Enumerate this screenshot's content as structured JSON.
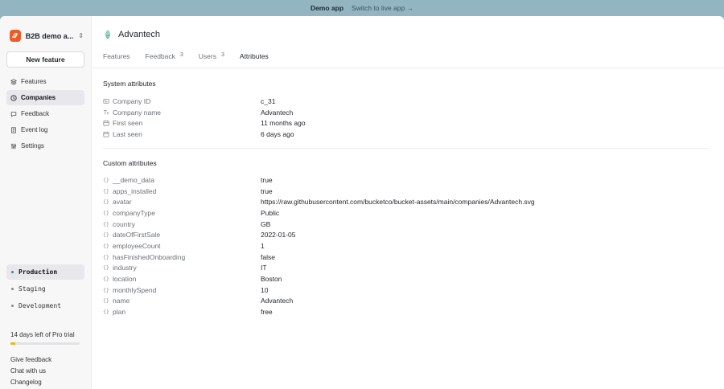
{
  "banner": {
    "demo_label": "Demo app",
    "switch_label": "Switch to live app →"
  },
  "sidebar": {
    "org_name": "B2B demo a...",
    "new_feature_label": "New feature",
    "nav": [
      {
        "label": "Features",
        "icon": "features-icon"
      },
      {
        "label": "Companies",
        "icon": "companies-icon",
        "active": true
      },
      {
        "label": "Feedback",
        "icon": "feedback-icon"
      },
      {
        "label": "Event log",
        "icon": "event-log-icon"
      },
      {
        "label": "Settings",
        "icon": "settings-icon"
      }
    ],
    "environments": [
      {
        "label": "Production",
        "active": true
      },
      {
        "label": "Staging"
      },
      {
        "label": "Development"
      }
    ],
    "trial_text": "14 days left of Pro trial",
    "trial_progress": 0.07,
    "links": [
      "Give feedback",
      "Chat with us",
      "Changelog"
    ]
  },
  "company": {
    "name": "Advantech"
  },
  "tabs": [
    {
      "label": "Features"
    },
    {
      "label": "Feedback",
      "count": "3"
    },
    {
      "label": "Users",
      "count": "3"
    },
    {
      "label": "Attributes",
      "active": true
    }
  ],
  "system_attributes": {
    "title": "System attributes",
    "rows": [
      {
        "key": "Company ID",
        "value": "c_31",
        "icon": "id-icon"
      },
      {
        "key": "Company name",
        "value": "Advantech",
        "icon": "text-icon"
      },
      {
        "key": "First seen",
        "value": "11 months ago",
        "icon": "calendar-icon"
      },
      {
        "key": "Last seen",
        "value": "6 days ago",
        "icon": "calendar-icon"
      }
    ]
  },
  "custom_attributes": {
    "title": "Custom attributes",
    "rows": [
      {
        "key": "__demo_data",
        "value": "true"
      },
      {
        "key": "apps_installed",
        "value": "true"
      },
      {
        "key": "avatar",
        "value": "https://raw.githubusercontent.com/bucketco/bucket-assets/main/companies/Advantech.svg"
      },
      {
        "key": "companyType",
        "value": "Public"
      },
      {
        "key": "country",
        "value": "GB"
      },
      {
        "key": "dateOfFirstSale",
        "value": "2022-01-05"
      },
      {
        "key": "employeeCount",
        "value": "1"
      },
      {
        "key": "hasFinishedOnboarding",
        "value": "false"
      },
      {
        "key": "industry",
        "value": "IT"
      },
      {
        "key": "location",
        "value": "Boston"
      },
      {
        "key": "monthlySpend",
        "value": "10"
      },
      {
        "key": "name",
        "value": "Advantech"
      },
      {
        "key": "plan",
        "value": "free"
      }
    ]
  },
  "colors": {
    "accent": "#f05a28",
    "trial": "#f2b417",
    "banner": "#93b4c1"
  }
}
